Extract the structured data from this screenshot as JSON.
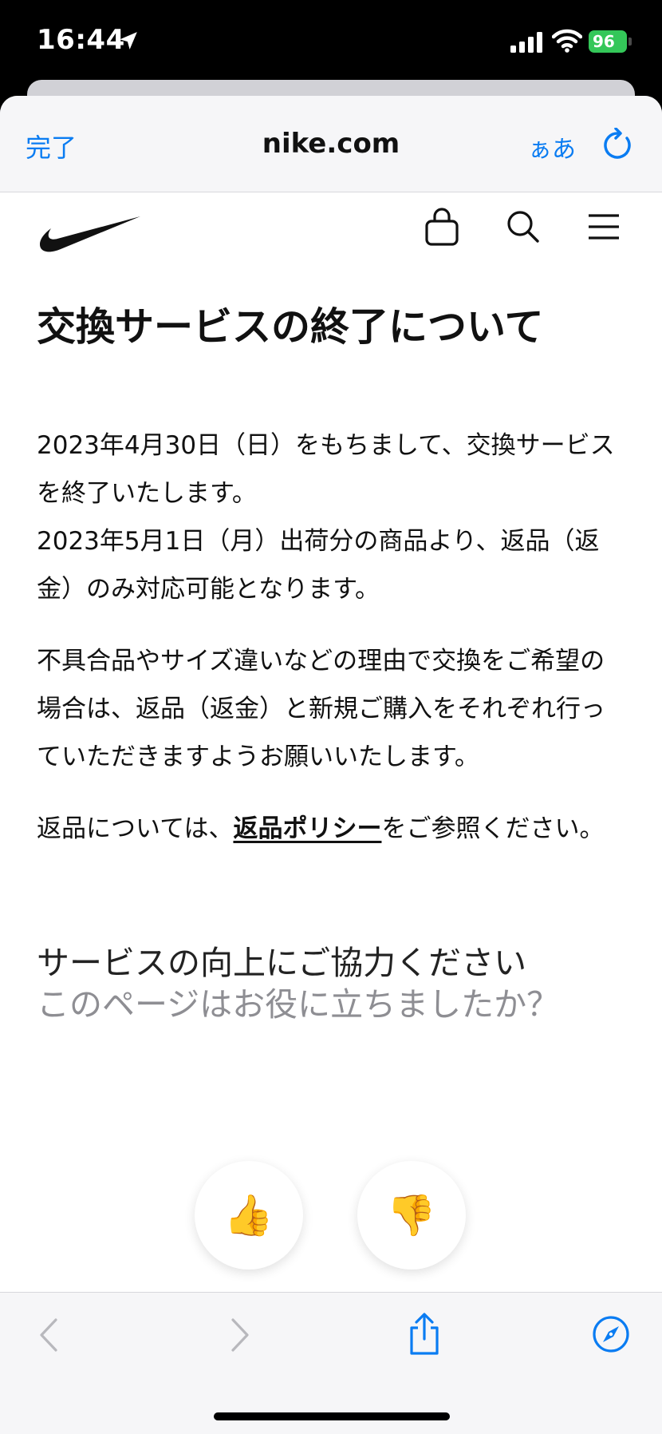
{
  "status_bar": {
    "time": "16:44",
    "battery": "96"
  },
  "browser": {
    "done_label": "完了",
    "site": "nike.com",
    "text_size_label": "ぁあ"
  },
  "icons": {
    "location": "location-arrow-icon",
    "signal": "cellular-signal-icon",
    "wifi": "wifi-icon",
    "reload": "reload-icon",
    "brand": "nike-swoosh-logo",
    "bag": "shopping-bag-icon",
    "search": "search-icon",
    "menu": "hamburger-menu-icon",
    "back": "chevron-left-icon",
    "forward": "chevron-right-icon",
    "share": "share-icon",
    "compass": "compass-icon"
  },
  "article": {
    "title": "交換サービスの終了について",
    "p1": "2023年4月30日（日）をもちまして、交換サービスを終了いたします。",
    "p2": "2023年5月1日（月）出荷分の商品より、返品（返金）のみ対応可能となります。",
    "p3": "不具合品やサイズ違いなどの理由で交換をご希望の場合は、返品（返金）と新規ご購入をそれぞれ行っていただきますようお願いいたします。",
    "p4_before": "返品については、",
    "p4_link": "返品ポリシー",
    "p4_after": "をご参照ください。"
  },
  "feedback": {
    "heading": "サービスの向上にご協力ください",
    "question": "このページはお役に立ちましたか？",
    "thumbs_up": "👍",
    "thumbs_down": "👎"
  },
  "colors": {
    "accent": "#0a7cf2",
    "battery": "#34c759",
    "muted_text": "#8e8e93"
  }
}
